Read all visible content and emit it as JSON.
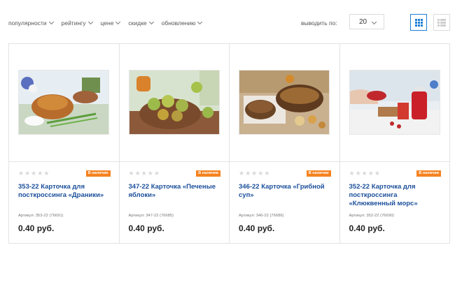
{
  "sort": {
    "items": [
      "популярности",
      "рейтингу",
      "цене",
      "скидке",
      "обновлению"
    ]
  },
  "per_page": {
    "label": "выводить по:",
    "value": "20"
  },
  "view": {
    "grid_icon": "grid-view-icon",
    "list_icon": "list-view-icon",
    "active_color": "#1d7ed8"
  },
  "products": [
    {
      "badge": "В наличии",
      "title": "353-22 Карточка для посткроссинга «Драники»",
      "sku": "Артикул: 353-22 (76691)",
      "price": "0.40 руб."
    },
    {
      "badge": "В наличии",
      "title": "347-22 Карточка «Печеные яблоки»",
      "sku": "Артикул: 347-22 (76685)",
      "price": "0.40 руб."
    },
    {
      "badge": "В наличии",
      "title": "346-22 Карточка «Грибной суп»",
      "sku": "Артикул: 346-22 (76686)",
      "price": "0.40 руб."
    },
    {
      "badge": "В наличии",
      "title": "352-22 Карточка для посткроссинга «Клюквенный морс»",
      "sku": "Артикул: 352-22 (76690)",
      "price": "0.40 руб."
    }
  ],
  "colors": {
    "badge": "#f58220",
    "title_link": "#1b4f9b",
    "accent": "#1d7ed8"
  }
}
